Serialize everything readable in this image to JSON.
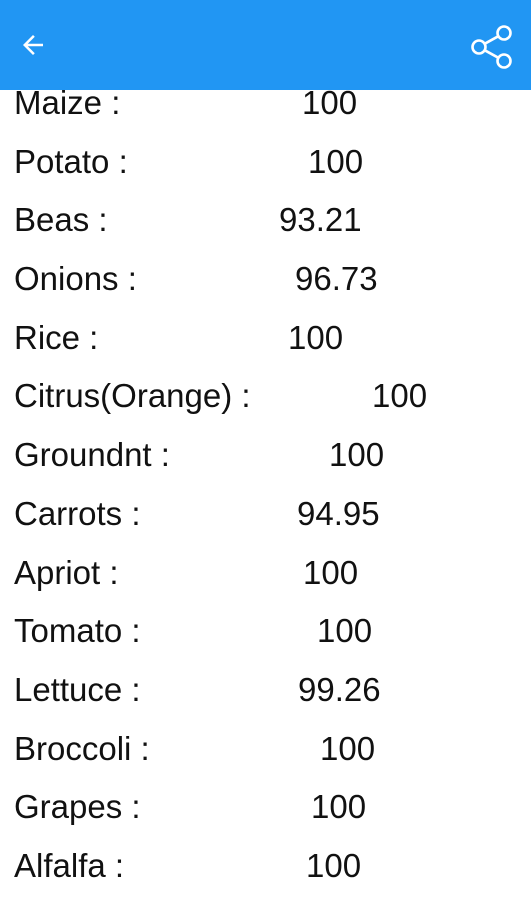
{
  "toolbar": {
    "back_icon": "arrow-left-icon",
    "share_icon": "share-icon",
    "color": "#2196f3"
  },
  "items": [
    {
      "label": "Maize :",
      "value": "100"
    },
    {
      "label": "Potato :",
      "value": "100"
    },
    {
      "label": "Beas :",
      "value": "93.21"
    },
    {
      "label": "Onions :",
      "value": "96.73"
    },
    {
      "label": "Rice :",
      "value": "100"
    },
    {
      "label": "Citrus(Orange) :",
      "value": "100"
    },
    {
      "label": "Groundnt :",
      "value": "100"
    },
    {
      "label": "Carrots :",
      "value": "94.95"
    },
    {
      "label": "Apriot :",
      "value": "100"
    },
    {
      "label": "Tomato :",
      "value": "100"
    },
    {
      "label": "Lettuce :",
      "value": "99.26"
    },
    {
      "label": "Broccoli :",
      "value": "100"
    },
    {
      "label": "Grapes :",
      "value": "100"
    },
    {
      "label": "Alfalfa :",
      "value": "100"
    }
  ]
}
